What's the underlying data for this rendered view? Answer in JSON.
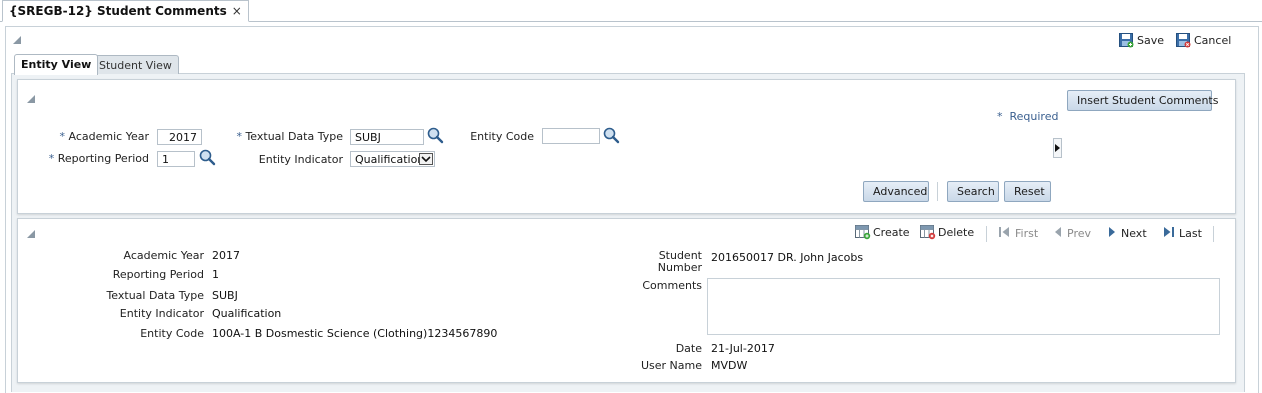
{
  "document_tab": {
    "title": "{SREGB-12} Student Comments",
    "close_symbol": "×"
  },
  "toolbar": {
    "save_label": "Save",
    "cancel_label": "Cancel"
  },
  "view_tabs": {
    "entity_view": "Entity View",
    "student_view": "Student View"
  },
  "search_panel": {
    "insert_button": "Insert Student Comments",
    "required_marker": "*",
    "required_text": "Required",
    "academic_year": {
      "marker": "*",
      "label": "Academic Year",
      "value": "2017"
    },
    "textual_data_type": {
      "marker": "*",
      "label": "Textual Data Type",
      "value": "SUBJ"
    },
    "entity_code": {
      "label": "Entity Code",
      "value": ""
    },
    "reporting_period": {
      "marker": "*",
      "label": "Reporting Period",
      "value": "1"
    },
    "entity_indicator": {
      "label": "Entity Indicator",
      "value": "Qualification"
    },
    "advanced_button": "Advanced",
    "search_button": "Search",
    "reset_button": "Reset"
  },
  "record_toolbar": {
    "create": "Create",
    "delete": "Delete",
    "first": "First",
    "prev": "Prev",
    "next": "Next",
    "last": "Last"
  },
  "record": {
    "academic_year": {
      "label": "Academic Year",
      "value": "2017"
    },
    "reporting_period": {
      "label": "Reporting Period",
      "value": "1"
    },
    "textual_data_type": {
      "label": "Textual Data Type",
      "value": "SUBJ"
    },
    "entity_indicator": {
      "label": "Entity Indicator",
      "value": "Qualification"
    },
    "entity_code": {
      "label": "Entity Code",
      "value": "100A-1  B Dosmestic Science (Clothing)1234567890"
    },
    "student_number": {
      "label_line1": "Student",
      "label_line2": "Number",
      "value": "201650017  DR. John Jacobs"
    },
    "comments": {
      "label": "Comments",
      "value": ""
    },
    "date": {
      "label": "Date",
      "value": "21-Jul-2017"
    },
    "user_name": {
      "label": "User Name",
      "value": "MVDW"
    }
  },
  "colors": {
    "accent_blue": "#3a5f8f",
    "button_gradient_top": "#e6eef7",
    "button_gradient_bottom": "#c9d8e8",
    "panel_background": "#eef2f5"
  }
}
